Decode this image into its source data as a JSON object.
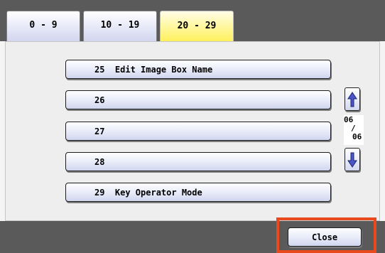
{
  "tabs": [
    {
      "label": "0 - 9",
      "active": false
    },
    {
      "label": "10 - 19",
      "active": false
    },
    {
      "label": "20 - 29",
      "active": true
    }
  ],
  "items": [
    {
      "label": "25  Edit Image Box Name"
    },
    {
      "label": "26"
    },
    {
      "label": "27"
    },
    {
      "label": "28"
    },
    {
      "label": "29  Key Operator Mode"
    }
  ],
  "pager": {
    "current": "06",
    "separator": "/",
    "total": "06"
  },
  "scroll": {
    "up_icon": "arrow-up",
    "down_icon": "arrow-down"
  },
  "footer": {
    "close_label": "Close"
  },
  "colors": {
    "bar": "#5a5a5a",
    "active_tab": "#fff05a",
    "button_blue": "#d0d6ef",
    "arrow": "#4a55c8",
    "highlight": "#e8491d"
  }
}
